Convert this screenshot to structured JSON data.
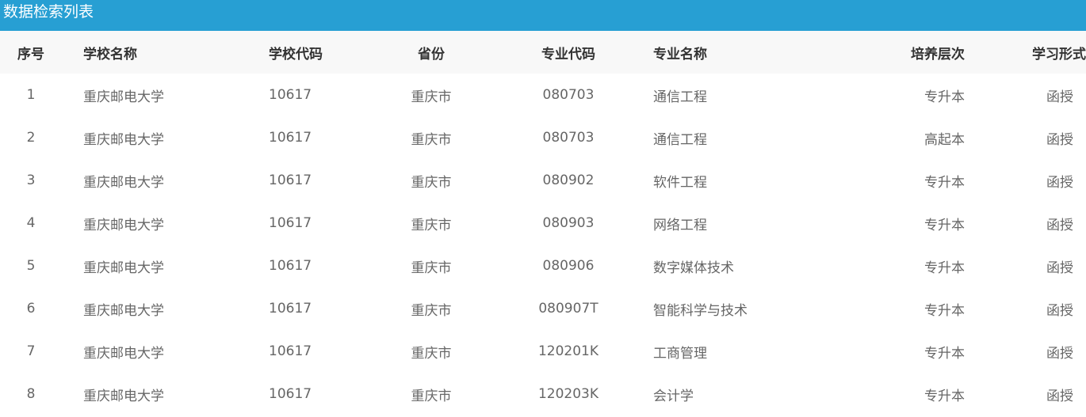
{
  "title": "数据检索列表",
  "headers": {
    "index": "序号",
    "school": "学校名称",
    "school_code": "学校代码",
    "province": "省份",
    "major_code": "专业代码",
    "major_name": "专业名称",
    "level": "培养层次",
    "mode": "学习形式"
  },
  "rows": [
    {
      "index": "1",
      "school": "重庆邮电大学",
      "school_code": "10617",
      "province": "重庆市",
      "major_code": "080703",
      "major_name": "通信工程",
      "level": "专升本",
      "mode": "函授"
    },
    {
      "index": "2",
      "school": "重庆邮电大学",
      "school_code": "10617",
      "province": "重庆市",
      "major_code": "080703",
      "major_name": "通信工程",
      "level": "高起本",
      "mode": "函授"
    },
    {
      "index": "3",
      "school": "重庆邮电大学",
      "school_code": "10617",
      "province": "重庆市",
      "major_code": "080902",
      "major_name": "软件工程",
      "level": "专升本",
      "mode": "函授"
    },
    {
      "index": "4",
      "school": "重庆邮电大学",
      "school_code": "10617",
      "province": "重庆市",
      "major_code": "080903",
      "major_name": "网络工程",
      "level": "专升本",
      "mode": "函授"
    },
    {
      "index": "5",
      "school": "重庆邮电大学",
      "school_code": "10617",
      "province": "重庆市",
      "major_code": "080906",
      "major_name": "数字媒体技术",
      "level": "专升本",
      "mode": "函授"
    },
    {
      "index": "6",
      "school": "重庆邮电大学",
      "school_code": "10617",
      "province": "重庆市",
      "major_code": "080907T",
      "major_name": "智能科学与技术",
      "level": "专升本",
      "mode": "函授"
    },
    {
      "index": "7",
      "school": "重庆邮电大学",
      "school_code": "10617",
      "province": "重庆市",
      "major_code": "120201K",
      "major_name": "工商管理",
      "level": "专升本",
      "mode": "函授"
    },
    {
      "index": "8",
      "school": "重庆邮电大学",
      "school_code": "10617",
      "province": "重庆市",
      "major_code": "120203K",
      "major_name": "会计学",
      "level": "专升本",
      "mode": "函授"
    }
  ],
  "colors": {
    "title_bar": "#279fd3",
    "header_bg": "#f8f8f8",
    "header_text": "#333333",
    "cell_text": "#666666"
  }
}
